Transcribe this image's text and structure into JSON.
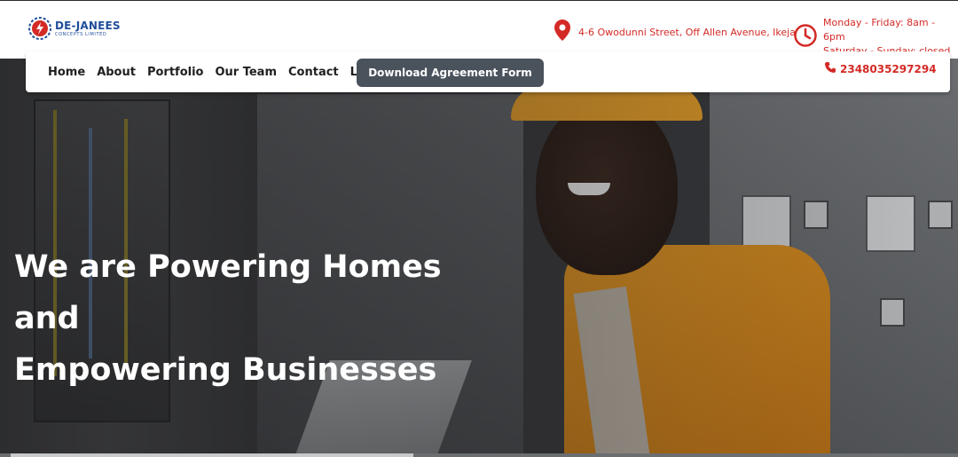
{
  "brand": {
    "name": "DE-JANEES",
    "sub": "CONCEPTS LIMITED"
  },
  "header": {
    "address": "4-6 Owodunni Street, Off Allen Avenue, Ikeja",
    "hours_weekday": "Monday - Friday: 8am - 6pm",
    "hours_weekend": "Saturday - Sunday: closed"
  },
  "nav": {
    "items": [
      {
        "label": "Home"
      },
      {
        "label": "About"
      },
      {
        "label": "Portfolio"
      },
      {
        "label": "Our Team"
      },
      {
        "label": "Contact"
      },
      {
        "label": "Login"
      }
    ],
    "download_label": "Download Agreement Form",
    "phone": "2348035297294"
  },
  "hero": {
    "line1": "We are Powering Homes and",
    "line2": "Empowering Businesses"
  },
  "colors": {
    "accent_red": "#d32a26",
    "brand_blue": "#1f4e9c",
    "button_bg": "#4a525c"
  },
  "icons": {
    "location": "location-pin-icon",
    "clock": "clock-icon",
    "phone": "phone-icon"
  }
}
